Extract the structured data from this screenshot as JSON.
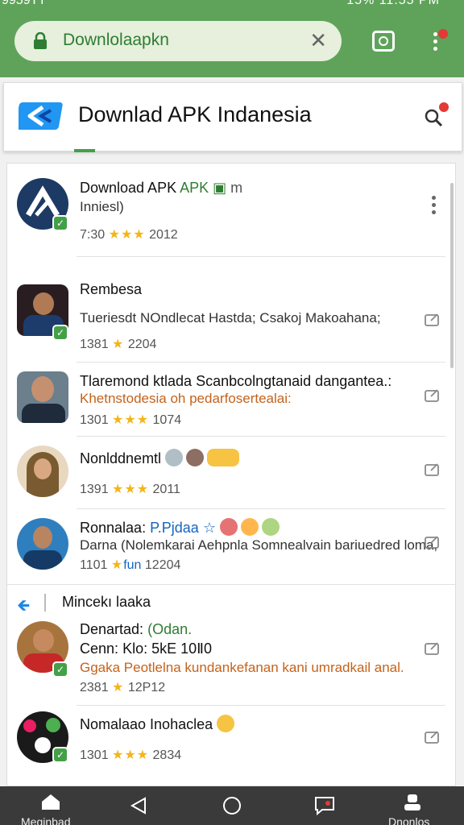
{
  "status_bar": {
    "left": "9959TT",
    "right": "15% 11:55 PM"
  },
  "browser": {
    "url_text": "Downlolaapkn"
  },
  "site": {
    "title": "Downlad APK Indanesia"
  },
  "list": [
    {
      "title": "Download APK",
      "title_suffix": "m",
      "subtitle": "Inniesl)",
      "meta_num": "7:30",
      "stars": "★★★",
      "year": "2012"
    },
    {
      "title": "Rembesa",
      "subtitle": "Tueriesdt  NOndlecat Hastda; Csakoj Makoahana;",
      "meta_num": "1381",
      "stars": "★",
      "year": "2204"
    },
    {
      "title": "Tlaremond ktlada Scanbcolngtanaid dangantea.:",
      "subtitle": "Khetnstodesia oh pedarfosertealai:",
      "meta_num": "1301",
      "stars": "★★★",
      "year": "1074"
    },
    {
      "title": "Nonlddnemtl",
      "meta_num": "1391",
      "stars": "★★★",
      "year": "2011"
    },
    {
      "title": "Ronnalaa:",
      "title_suffix": "P.Pjdaa",
      "subtitle": "Darna (Nolemkarai Aehpnla Somnealvain bariuedred loma,",
      "meta_num": "1101",
      "stars": "★",
      "year_prefix": "fun",
      "year": "12204"
    },
    {
      "title": "Denartad:",
      "title_suffix": "(Odan.",
      "line2": "Cenn:",
      "line2_suffix": "Klo: 5kE 10Ⅱ0",
      "subtitle": "Ggaka Peotlelna  kundankefanan kani umradkail anal.",
      "meta_num": "2381",
      "stars": "★",
      "year": "12P12"
    },
    {
      "title": "Nomalaao Inohaclea",
      "meta_num": "1301",
      "stars": "★★★",
      "year": "2834"
    }
  ],
  "section": {
    "label": "Mincekı laaka"
  },
  "bottom_nav": {
    "home_label": "Meginbad",
    "profile_label": "Dnonlos"
  },
  "colors": {
    "toolbar": "#5fa35a",
    "accent_green": "#43a047",
    "star": "#f2b51b",
    "nav": "#3a3a3a"
  }
}
